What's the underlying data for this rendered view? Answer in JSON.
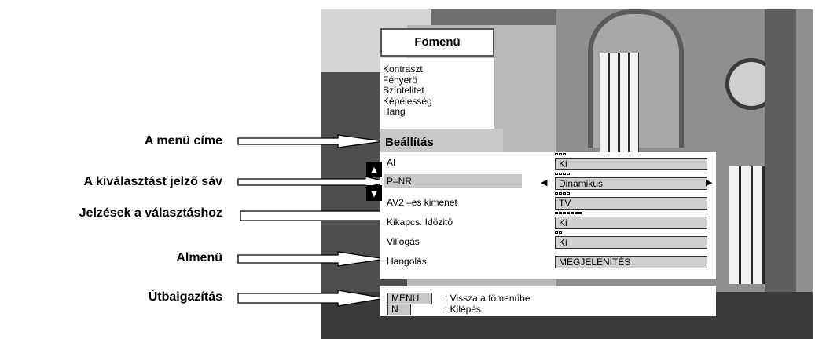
{
  "annotations": {
    "menu_title": "A menü címe",
    "selection_bar": "A kiválasztást jelző sáv",
    "option_marks": "Jelzések a választáshoz",
    "submenu": "Almenü",
    "guidance": "Útbaigazítás"
  },
  "main_menu": {
    "title": "Fömenü",
    "items": [
      "Kontraszt",
      "Fényerö",
      "Színtelitet",
      "Képélesség",
      "Hang"
    ],
    "selected": "Beállítás"
  },
  "settings": [
    {
      "label": "AI",
      "value": "Ki",
      "option_count": 3
    },
    {
      "label": "P–NR",
      "value": "Dinamikus",
      "option_count": 4,
      "selected": true
    },
    {
      "label": "AV2 –es kimenet",
      "value": "TV",
      "option_count": 4
    },
    {
      "label": "Kikapcs. Idözitö",
      "value": "Ki",
      "option_count": 7
    },
    {
      "label": "Villogás",
      "value": "Ki",
      "option_count": 2
    },
    {
      "label": "Hangolás",
      "value": "MEGJELENÍTÉS"
    }
  ],
  "nav": [
    {
      "key": "MENU",
      "text": ": Vissza a fömenübe"
    },
    {
      "key": "N",
      "text": ": Kilépés"
    }
  ],
  "icons": {
    "scroll_up": "▲",
    "scroll_down": "▼",
    "value_left": "◀",
    "value_right": "▶"
  }
}
